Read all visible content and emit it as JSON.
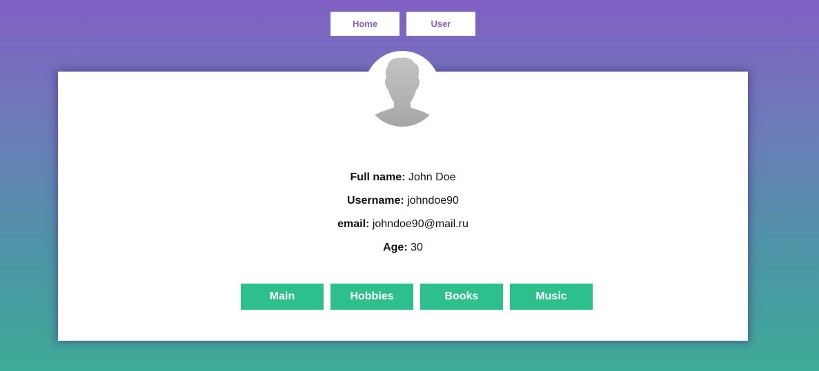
{
  "nav": {
    "items": [
      {
        "label": "Home"
      },
      {
        "label": "User"
      }
    ]
  },
  "avatar": {
    "icon": "user-silhouette-icon"
  },
  "profile": {
    "fields": [
      {
        "label": "Full name:",
        "value": "John Doe"
      },
      {
        "label": "Username:",
        "value": "johndoe90"
      },
      {
        "label": "email:",
        "value": "johndoe90@mail.ru"
      },
      {
        "label": "Age:",
        "value": "30"
      }
    ]
  },
  "tabs": {
    "items": [
      {
        "label": "Main"
      },
      {
        "label": "Hobbies"
      },
      {
        "label": "Books"
      },
      {
        "label": "Music"
      }
    ]
  },
  "colors": {
    "gradient_top": "#8160c3",
    "gradient_bottom": "#3eab97",
    "accent_green": "#2dbf8c",
    "nav_text": "#8160c3"
  }
}
